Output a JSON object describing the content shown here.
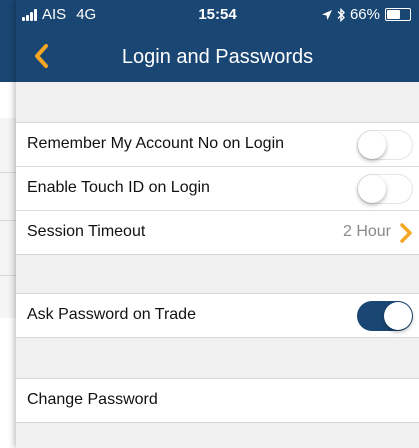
{
  "status_bar": {
    "carrier": "AIS",
    "network": "4G",
    "time": "15:54",
    "battery": "66%",
    "battery_level": 0.66
  },
  "nav": {
    "title": "Login and Passwords",
    "back_icon": "chevron-left-icon"
  },
  "settings": {
    "remember_account": {
      "label": "Remember My Account No on Login",
      "enabled": false
    },
    "touch_id": {
      "label": "Enable Touch ID on Login",
      "enabled": false
    },
    "session_timeout": {
      "label": "Session Timeout",
      "value": "2 Hour"
    },
    "ask_password": {
      "label": "Ask Password on Trade",
      "enabled": true
    },
    "change_password": {
      "label": "Change Password"
    }
  },
  "colors": {
    "brand": "#1a4673",
    "accent": "#f5a623",
    "background": "#f0f0f0"
  }
}
